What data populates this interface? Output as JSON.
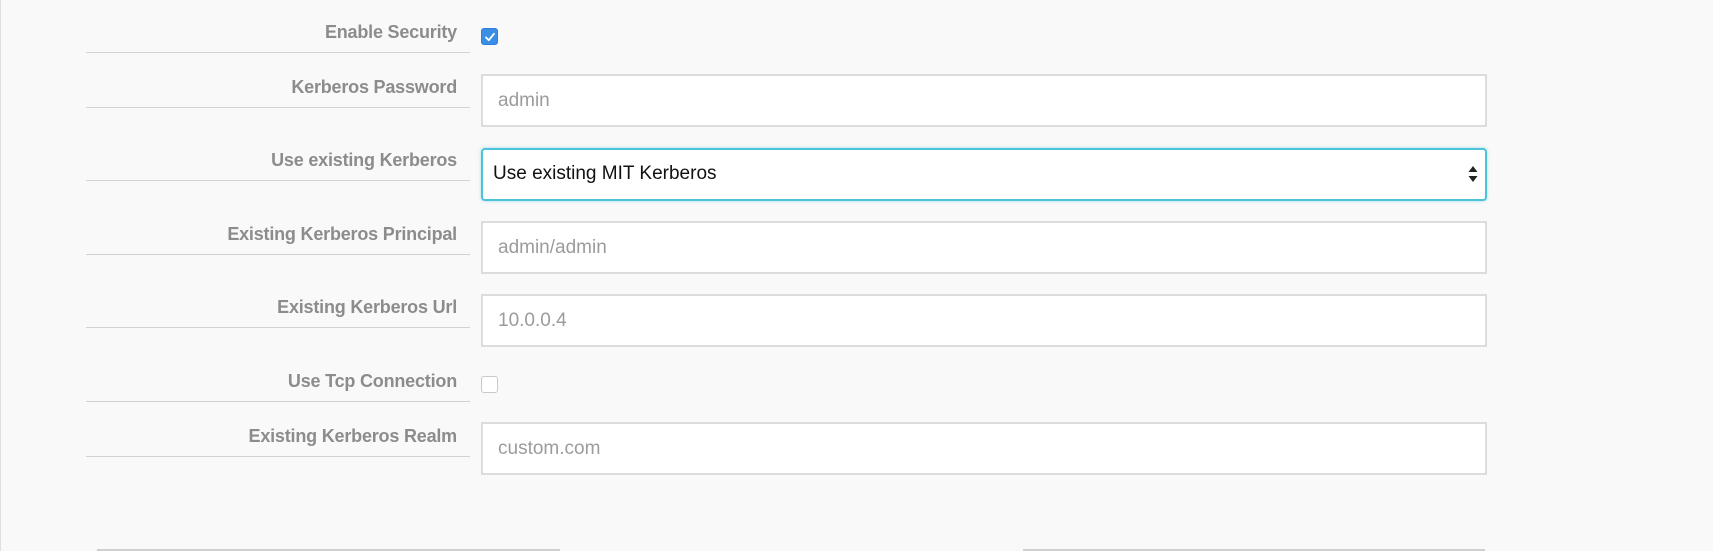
{
  "form": {
    "enable_security": {
      "label": "Enable Security",
      "checked": true
    },
    "kerberos_password": {
      "label": "Kerberos Password",
      "value": "admin"
    },
    "use_existing_kerberos": {
      "label": "Use existing Kerberos",
      "selected": "Use existing MIT Kerberos"
    },
    "existing_kerberos_principal": {
      "label": "Existing Kerberos Principal",
      "value": "admin/admin"
    },
    "existing_kerberos_url": {
      "label": "Existing Kerberos Url",
      "value": "10.0.0.4"
    },
    "use_tcp_connection": {
      "label": "Use Tcp Connection",
      "checked": false
    },
    "existing_kerberos_realm": {
      "label": "Existing Kerberos Realm",
      "value": "custom.com"
    }
  },
  "colors": {
    "checkbox_checked": "#3a8ee6",
    "focus_border": "#4cc3d9",
    "label_text": "#8c8c8c"
  },
  "icons": {
    "checkmark": "checkmark-icon",
    "select_arrows": "select-arrows-icon"
  }
}
